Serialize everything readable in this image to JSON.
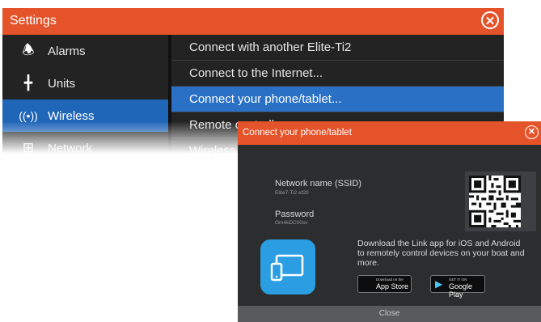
{
  "settings": {
    "title": "Settings",
    "close_glyph": "✕",
    "sidebar": [
      {
        "label": "Alarms",
        "icon": "alarm-bell-icon",
        "glyph": "🕭"
      },
      {
        "label": "Units",
        "icon": "units-icon",
        "glyph": "╋"
      },
      {
        "label": "Wireless",
        "icon": "wireless-icon",
        "glyph": "((•))",
        "active": true
      },
      {
        "label": "Network",
        "icon": "network-icon",
        "glyph": "⊞"
      }
    ],
    "menu": [
      {
        "label": "Connect with another Elite-Ti2"
      },
      {
        "label": "Connect to the Internet..."
      },
      {
        "label": "Connect your phone/tablet...",
        "active": true
      },
      {
        "label": "Remote controllers"
      },
      {
        "label": "Wireless settings"
      }
    ]
  },
  "dialog": {
    "title": "Connect your phone/tablet",
    "close_glyph": "✕",
    "network_label": "Network name (SSID)",
    "network_value": "Elite7-Ti2 ef20",
    "password_label": "Password",
    "password_value": "Gm4kDC00sv",
    "description": "Download the Link app for iOS and Android to remotely control devices on your boat and more.",
    "app_store": {
      "small": "Download on the",
      "big": "App Store",
      "glyph": ""
    },
    "google_play": {
      "small": "GET IT ON",
      "big": "Google Play",
      "glyph": "▶"
    },
    "close_label": "Close"
  },
  "colors": {
    "title_orange": "#e5532a",
    "selection_blue": "#2a71c6",
    "panel_dark": "#232323"
  }
}
